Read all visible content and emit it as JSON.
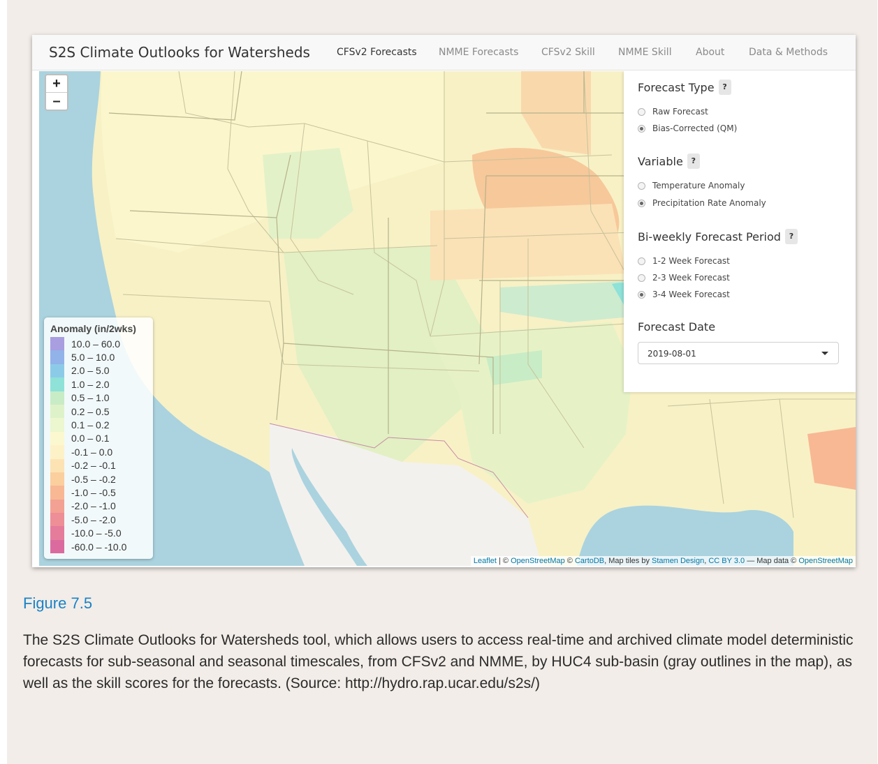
{
  "navbar": {
    "brand": "S2S Climate Outlooks for Watersheds",
    "items": [
      {
        "label": "CFSv2 Forecasts",
        "active": true
      },
      {
        "label": "NMME Forecasts",
        "active": false
      },
      {
        "label": "CFSv2 Skill",
        "active": false
      },
      {
        "label": "NMME Skill",
        "active": false
      },
      {
        "label": "About",
        "active": false
      },
      {
        "label": "Data & Methods",
        "active": false
      }
    ]
  },
  "zoom": {
    "in": "+",
    "out": "–"
  },
  "legend": {
    "title": "Anomaly (in/2wks)",
    "items": [
      {
        "label": "10.0 – 60.0",
        "color": "#a89ee0"
      },
      {
        "label": "5.0 – 10.0",
        "color": "#92b2ea"
      },
      {
        "label": "2.0 – 5.0",
        "color": "#8ccbe8"
      },
      {
        "label": "1.0 – 2.0",
        "color": "#8ee2d8"
      },
      {
        "label": "0.5 – 1.0",
        "color": "#c8ecc6"
      },
      {
        "label": "0.2 – 0.5",
        "color": "#def2c9"
      },
      {
        "label": "0.1 – 0.2",
        "color": "#ecf6cf"
      },
      {
        "label": "0.0 – 0.1",
        "color": "#fbf8d0"
      },
      {
        "label": "-0.1 – 0.0",
        "color": "#fdf1c8"
      },
      {
        "label": "-0.2 – -0.1",
        "color": "#fde3b4"
      },
      {
        "label": "-0.5 – -0.2",
        "color": "#fbcf9e"
      },
      {
        "label": "-1.0 – -0.5",
        "color": "#f8b894"
      },
      {
        "label": "-2.0 – -1.0",
        "color": "#f3a193"
      },
      {
        "label": "-5.0 – -2.0",
        "color": "#ee8e96"
      },
      {
        "label": "-10.0 – -5.0",
        "color": "#e57c9c"
      },
      {
        "label": "-60.0 – -10.0",
        "color": "#db6b9f"
      }
    ]
  },
  "panel": {
    "forecast_type": {
      "heading": "Forecast Type",
      "help": "?",
      "options": [
        {
          "label": "Raw Forecast",
          "checked": false
        },
        {
          "label": "Bias-Corrected (QM)",
          "checked": true
        }
      ]
    },
    "variable": {
      "heading": "Variable",
      "help": "?",
      "options": [
        {
          "label": "Temperature Anomaly",
          "checked": false
        },
        {
          "label": "Precipitation Rate Anomaly",
          "checked": true
        }
      ]
    },
    "period": {
      "heading": "Bi-weekly Forecast Period",
      "help": "?",
      "options": [
        {
          "label": "1-2 Week Forecast",
          "checked": false
        },
        {
          "label": "2-3 Week Forecast",
          "checked": false
        },
        {
          "label": "3-4 Week Forecast",
          "checked": true
        }
      ]
    },
    "date": {
      "heading": "Forecast Date",
      "value": "2019-08-01"
    }
  },
  "attribution": {
    "leaflet": "Leaflet",
    "sep1": " | © ",
    "osm1": "OpenStreetMap",
    "sep2": " © ",
    "carto": "CartoDB",
    "mid": ", Map tiles by ",
    "stamen": "Stamen Design",
    "comma": ", ",
    "ccby": "CC BY 3.0",
    "tail": " — Map data © ",
    "osm2": "OpenStreetMap"
  },
  "figure": {
    "title": "Figure 7.5",
    "caption": "The S2S Climate Outlooks for Watersheds tool, which allows users to access real-time and archived climate model deterministic forecasts for sub-seasonal and seasonal timescales, from CFSv2 and NMME, by HUC4 sub-basin (gray outlines in the map), as well as the skill scores for the forecasts. (Source: http://hydro.rap.ucar.edu/s2s/)"
  },
  "colors": {
    "ocean": "#aad3df",
    "land_base": "#f8f1c6",
    "mexico": "#f3f1ee",
    "title_blue": "#1b82c6"
  }
}
